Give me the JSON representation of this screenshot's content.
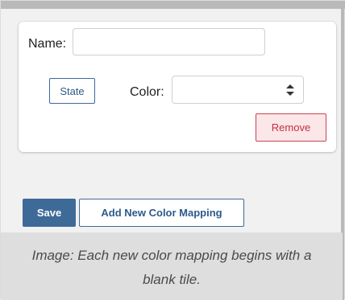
{
  "form": {
    "name_label": "Name:",
    "name_value": "",
    "state_button_label": "State",
    "color_label": "Color:",
    "color_value": "",
    "remove_button_label": "Remove"
  },
  "actions": {
    "save_label": "Save",
    "add_mapping_label": "Add New Color Mapping"
  },
  "caption": "Image: Each new color mapping begins with a blank tile.",
  "colors": {
    "primary": "#3e6a98",
    "danger": "#c4303f",
    "danger_bg": "#fbe6e8",
    "caption_bg": "#dedede"
  },
  "icons": {
    "select_arrows": "up-down-arrows-icon"
  }
}
